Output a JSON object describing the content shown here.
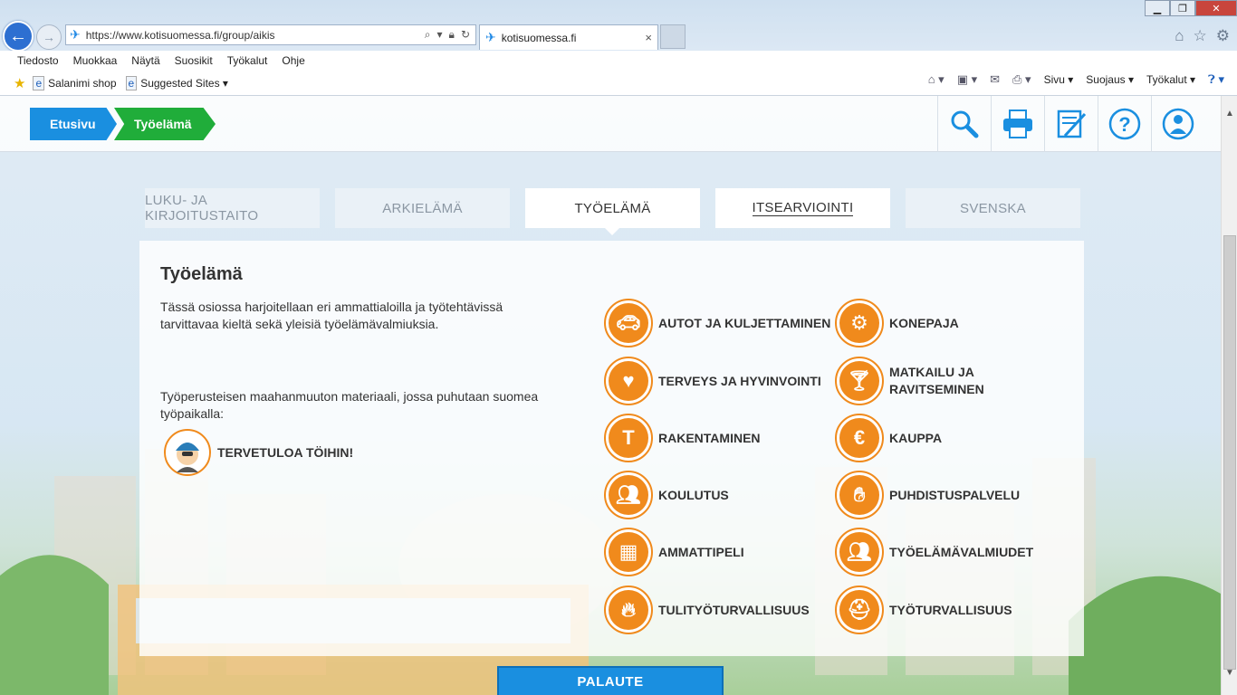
{
  "browser": {
    "url": "https://www.kotisuomessa.fi/group/aikis",
    "tab_title": "kotisuomessa.fi",
    "tab_close": "×",
    "menu": [
      "Tiedosto",
      "Muokkaa",
      "Näytä",
      "Suosikit",
      "Työkalut",
      "Ohje"
    ],
    "favorites": [
      {
        "label": "Salanimi shop",
        "icon": "ie-page-icon"
      },
      {
        "label": "Suggested Sites ▾",
        "icon": "ie-page-icon"
      }
    ],
    "commands": [
      "Sivu ▾",
      "Suojaus ▾",
      "Työkalut ▾"
    ]
  },
  "site": {
    "breadcrumb": {
      "home": "Etusivu",
      "current": "Työelämä"
    },
    "tools": [
      "search-icon",
      "print-icon",
      "edit-icon",
      "help-icon",
      "profile-icon"
    ],
    "tabs": [
      {
        "label": "LUKU- JA KIRJOITUSTAITO",
        "state": "dim"
      },
      {
        "label": "ARKIELÄMÄ",
        "state": "dim"
      },
      {
        "label": "TYÖELÄMÄ",
        "state": "active"
      },
      {
        "label": "ITSEARVIOINTI",
        "state": "link"
      },
      {
        "label": "SVENSKA",
        "state": "dim"
      }
    ],
    "panel": {
      "title": "Työelämä",
      "intro": "Tässä osiossa harjoitellaan eri ammattialoilla ja työtehtävissä tarvittavaa kieltä sekä yleisiä työelämävalmiuksia.",
      "intro2": "Työperusteisen maahanmuuton materiaali, jossa puhutaan suomea työpaikalla:",
      "welcome": "TERVETULOA TÖIHIN!",
      "topics_left": [
        {
          "label": "AUTOT JA KULJETTAMINEN",
          "icon": "car-icon"
        },
        {
          "label": "TERVEYS JA HYVINVOINTI",
          "icon": "heart-icon"
        },
        {
          "label": "RAKENTAMINEN",
          "icon": "hammer-icon"
        },
        {
          "label": "KOULUTUS",
          "icon": "classroom-icon"
        },
        {
          "label": "AMMATTIPELI",
          "icon": "game-grid-icon"
        },
        {
          "label": "TULITYÖTURVALLISUUS",
          "icon": "fire-icon"
        }
      ],
      "topics_right": [
        {
          "label": "KONEPAJA",
          "icon": "gear-icon"
        },
        {
          "label": "MATKAILU JA RAVITSEMINEN",
          "icon": "suitcase-icon"
        },
        {
          "label": "KAUPPA",
          "icon": "money-icon"
        },
        {
          "label": "PUHDISTUSPALVELU",
          "icon": "gloves-icon"
        },
        {
          "label": "TYÖELÄMÄVALMIUDET",
          "icon": "teamwork-icon"
        },
        {
          "label": "TYÖTURVALLISUUS",
          "icon": "helmet-icon"
        }
      ]
    },
    "feedback": "PALAUTE"
  },
  "colors": {
    "home_crumb": "#1a8fe0",
    "current_crumb": "#20ad3a",
    "topic_orange": "#f08a1c",
    "feedback": "#1a8fe0"
  }
}
